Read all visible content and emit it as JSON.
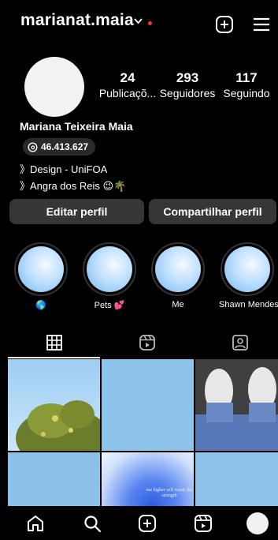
{
  "header": {
    "username": "marianat.maia"
  },
  "profile": {
    "posts": {
      "count": "24",
      "label": "Publicaçõ..."
    },
    "followers": {
      "count": "293",
      "label": "Seguidores"
    },
    "following": {
      "count": "117",
      "label": "Seguindo"
    },
    "full_name": "Mariana Teixeira Maia",
    "threads_handle": "46.413.627",
    "bio_lines": [
      "》Design - UniFOA",
      "》Angra dos Reis 😉🌴"
    ]
  },
  "actions": {
    "edit_label": "Editar perfil",
    "share_label": "Compartilhar perfil"
  },
  "highlights": [
    {
      "label": "🌎"
    },
    {
      "label": "Pets 💕"
    },
    {
      "label": "Me"
    },
    {
      "label": "Shawn Mendes"
    }
  ],
  "tabs": [
    {
      "icon": "grid-icon",
      "active": true
    },
    {
      "icon": "reels-icon",
      "active": false
    },
    {
      "icon": "tagged-icon",
      "active": false
    }
  ],
  "grid": {
    "cell5_text": "me higher self wants the strength"
  },
  "colors": {
    "notification_dot": "#ff3040",
    "button_bg": "#363636",
    "background": "#000000"
  },
  "bottom_nav": [
    "home-icon",
    "search-icon",
    "create-icon",
    "reels-icon",
    "profile-avatar"
  ]
}
